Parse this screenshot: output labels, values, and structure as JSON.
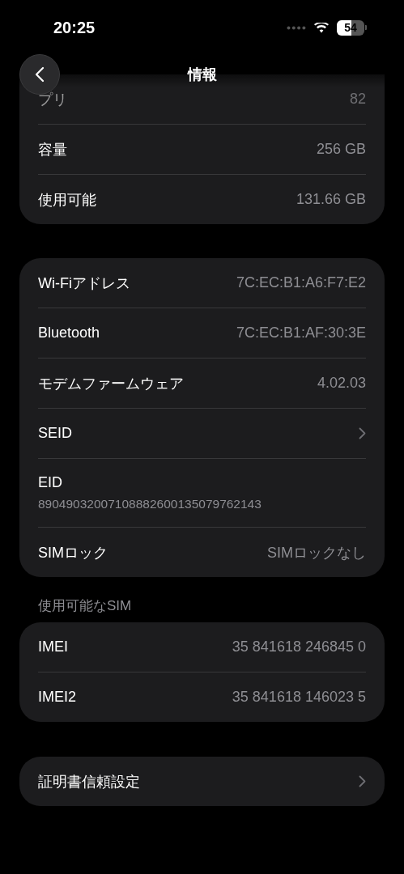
{
  "status_bar": {
    "time": "20:25",
    "battery": "54"
  },
  "nav": {
    "title": "情報"
  },
  "groups": [
    {
      "rows": [
        {
          "kind": "value",
          "label": "プリ",
          "value": "82",
          "faded": true
        },
        {
          "kind": "value",
          "label": "容量",
          "value": "256 GB",
          "faded": false
        },
        {
          "kind": "value",
          "label": "使用可能",
          "value": "131.66 GB",
          "faded": false
        }
      ],
      "cut_top": true
    },
    {
      "rows": [
        {
          "kind": "value",
          "label": "Wi-Fiアドレス",
          "value": "7C:EC:B1:A6:F7:E2",
          "faded": false
        },
        {
          "kind": "value",
          "label": "Bluetooth",
          "value": "7C:EC:B1:AF:30:3E",
          "faded": false
        },
        {
          "kind": "value",
          "label": "モデムファームウェア",
          "value": "4.02.03",
          "faded": false
        },
        {
          "kind": "link",
          "label": "SEID",
          "faded": false
        },
        {
          "kind": "detail",
          "label": "EID",
          "value": "89049032007108882600135079762143",
          "faded": false
        },
        {
          "kind": "value",
          "label": "SIMロック",
          "value": "SIMロックなし",
          "faded": false
        }
      ],
      "cut_top": false
    },
    {
      "header": "使用可能なSIM",
      "rows": [
        {
          "kind": "value",
          "label": "IMEI",
          "value": "35 841618 246845 0",
          "faded": false
        },
        {
          "kind": "value",
          "label": "IMEI2",
          "value": "35 841618 146023 5",
          "faded": false
        }
      ],
      "cut_top": false
    },
    {
      "rows": [
        {
          "kind": "link",
          "label": "証明書信頼設定",
          "faded": false
        }
      ],
      "cut_top": false
    }
  ]
}
